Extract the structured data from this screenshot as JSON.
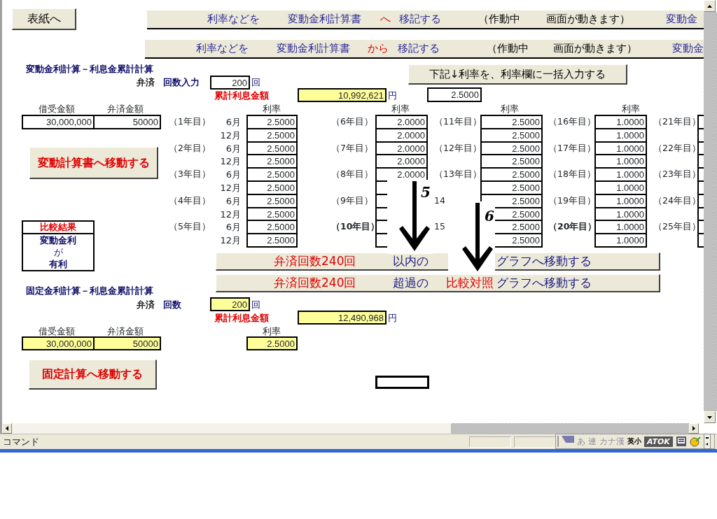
{
  "cover_button": "表紙へ",
  "banners": [
    {
      "segments": [
        {
          "text": "利率などを",
          "color": "#2a2a9a"
        },
        {
          "text": "変動金利計算書",
          "color": "#2a2a9a"
        },
        {
          "text": "へ",
          "color": "#e00000"
        },
        {
          "text": "移記する",
          "color": "#2a2a9a"
        },
        {
          "text": "（作動中",
          "color": "#000000"
        },
        {
          "text": "画面が動きます）",
          "color": "#000000"
        },
        {
          "text": "変動金",
          "color": "#2a2a9a"
        }
      ]
    },
    {
      "segments": [
        {
          "text": "利率などを",
          "color": "#2a2a9a"
        },
        {
          "text": "変動金利計算書",
          "color": "#2a2a9a"
        },
        {
          "text": "から",
          "color": "#e00000"
        },
        {
          "text": "移記する",
          "color": "#2a2a9a"
        },
        {
          "text": "（作動中",
          "color": "#000000"
        },
        {
          "text": "画面が動きます）",
          "color": "#000000"
        },
        {
          "text": "変動金",
          "color": "#2a2a9a"
        }
      ]
    }
  ],
  "variable": {
    "title": "変動金利計算－利息金累計計算",
    "count_label_a": "弁済",
    "count_label_b": "回数入力",
    "count": {
      "value": "200",
      "highlighted": false
    },
    "count_unit": "回",
    "total_label": "累計利息金額",
    "total": {
      "value": "10,992,621",
      "highlighted": true
    },
    "total_unit": "円",
    "bulk_rate": "2.5000",
    "bulk_button": "下記↓利率を、利率欄に一括入力する",
    "loan_header": "借受金額",
    "repay_header": "弁済金額",
    "loan": {
      "value": "30,000,000",
      "highlighted": false
    },
    "repay": {
      "value": "50000",
      "highlighted": false
    },
    "move_button": "変動計算書へ移動する"
  },
  "rate_blocks": [
    {
      "header": "利率",
      "rows": [
        {
          "year": "（1年目）",
          "bold": false,
          "month": "6月",
          "rate": "2.5000"
        },
        {
          "month": "12月",
          "rate": "2.5000"
        },
        {
          "year": "（2年目）",
          "bold": false,
          "month": "6月",
          "rate": "2.5000"
        },
        {
          "month": "12月",
          "rate": "2.5000"
        },
        {
          "year": "（3年目）",
          "bold": false,
          "month": "6月",
          "rate": "2.5000"
        },
        {
          "month": "12月",
          "rate": "2.5000"
        },
        {
          "year": "（4年目）",
          "bold": false,
          "month": "6月",
          "rate": "2.5000"
        },
        {
          "month": "12月",
          "rate": "2.5000"
        },
        {
          "year": "（5年目）",
          "bold": false,
          "month": "6月",
          "rate": "2.5000"
        },
        {
          "month": "12月",
          "rate": "2.5000"
        }
      ]
    },
    {
      "header": "利率",
      "rows": [
        {
          "year": "（6年目）",
          "bold": false,
          "rate": "2.0000"
        },
        {
          "rate": "2.0000"
        },
        {
          "year": "（7年目）",
          "bold": false,
          "rate": "2.0000"
        },
        {
          "rate": "2.0000"
        },
        {
          "year": "（8年目）",
          "bold": false,
          "rate": "2.0000"
        },
        {},
        {
          "year": "（9年目）",
          "bold": false
        },
        {},
        {
          "year": "（10年目）",
          "bold": true
        },
        {}
      ]
    },
    {
      "header": "利率",
      "rows": [
        {
          "year": "（11年目）",
          "bold": false,
          "rate": "2.5000"
        },
        {
          "rate": "2.5000"
        },
        {
          "year": "（12年目）",
          "bold": false,
          "rate": "2.5000"
        },
        {
          "rate": "2.5000"
        },
        {
          "year": "（13年目）",
          "bold": false,
          "rate": "2.5000"
        },
        {
          "rate": "2.5000"
        },
        {
          "year": "14",
          "bold": false,
          "rate": "2.5000"
        },
        {
          "rate": "2.5000"
        },
        {
          "year": "15",
          "bold": false,
          "rate": "2.5000"
        },
        {
          "rate": "2.5000"
        }
      ]
    },
    {
      "header": "利率",
      "rows": [
        {
          "year": "（16年目）",
          "bold": false,
          "rate": "1.0000"
        },
        {
          "rate": "1.0000"
        },
        {
          "year": "（17年目）",
          "bold": false,
          "rate": "1.0000"
        },
        {
          "rate": "1.0000"
        },
        {
          "year": "（18年目）",
          "bold": false,
          "rate": "1.0000"
        },
        {
          "rate": "1.0000"
        },
        {
          "year": "（19年目）",
          "bold": false,
          "rate": "1.0000"
        },
        {
          "rate": "1.0000"
        },
        {
          "year": "（20年目）",
          "bold": true,
          "rate": "1.0000"
        },
        {
          "rate": "1.0000"
        }
      ]
    },
    {
      "rows": [
        {
          "year": "（21年目）",
          "bold": false
        },
        {},
        {
          "year": "（22年目）",
          "bold": false
        },
        {},
        {
          "year": "（23年目）",
          "bold": false
        },
        {},
        {
          "year": "（24年目）",
          "bold": false
        },
        {},
        {
          "year": "（25年目）",
          "bold": false
        },
        {}
      ]
    }
  ],
  "comparison": {
    "title": "比較結果",
    "lines": [
      "変動金利",
      "が",
      "有利"
    ]
  },
  "graph_buttons": [
    {
      "segments": [
        {
          "text": "弁済回数240回",
          "color": "#e00000"
        },
        {
          "text": "以内の",
          "color": "#1a1a80"
        },
        {
          "text": "グラフへ移動する",
          "color": "#1a1a80"
        }
      ]
    },
    {
      "segments": [
        {
          "text": "弁済回数240回",
          "color": "#e00000"
        },
        {
          "text": "超過の",
          "color": "#1a1a80"
        },
        {
          "text": "比較対照",
          "color": "#e00000"
        },
        {
          "text": "グラフへ移動する",
          "color": "#1a1a80"
        }
      ]
    }
  ],
  "fixed": {
    "title": "固定金利計算－利息金累計計算",
    "count_label_a": "弁済",
    "count_label_b": "回数",
    "count": {
      "value": "200",
      "highlighted": true
    },
    "count_unit": "回",
    "total_label": "累計利息金額",
    "total": {
      "value": "12,490,968",
      "highlighted": true
    },
    "total_unit": "円",
    "loan_header": "借受金額",
    "repay_header": "弁済金額",
    "rate_header": "利率",
    "loan": {
      "value": "30,000,000",
      "highlighted": true
    },
    "repay": {
      "value": "50000",
      "highlighted": true
    },
    "rate": {
      "value": "2.5000",
      "highlighted": true
    },
    "move_button": "固定計算へ移動する"
  },
  "annotations": [
    {
      "label": "5"
    },
    {
      "label": "6"
    }
  ],
  "status_bar": {
    "mode": "コマンド"
  },
  "ime_toolbar": {
    "modes": [
      {
        "text": "あ",
        "disabled": true
      },
      {
        "text": "連",
        "disabled": true
      },
      {
        "text": "カナ漢",
        "disabled": true
      },
      {
        "text": "英小",
        "disabled": false
      }
    ],
    "brand": "ATOK"
  }
}
